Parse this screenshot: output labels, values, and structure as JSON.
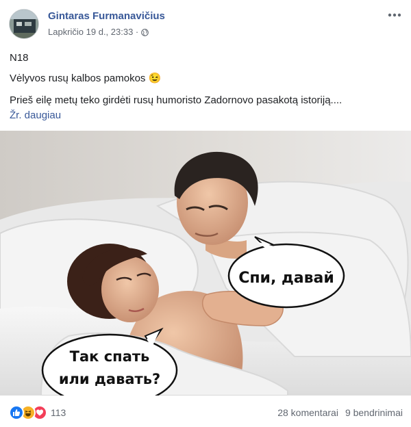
{
  "post": {
    "author": "Gintaras Furmanavičius",
    "timestamp": "Lapkričio 19 d., 23:33 ·",
    "privacy_icon": "globe-icon",
    "more_icon": "ellipsis-icon",
    "lines": [
      "N18",
      "Vėlyvos rusų kalbos pamokos 😉",
      "Prieš eilę metų teko girdėti rusų humoristo Zadornovo pasakotą istoriją...."
    ],
    "see_more": "Žr. daugiau"
  },
  "image": {
    "bubble_right": "Спи, давай",
    "bubble_left_line1": "Так спать",
    "bubble_left_line2": "или давать?"
  },
  "footer": {
    "reaction_icons": [
      "like-icon",
      "haha-icon",
      "love-icon"
    ],
    "reaction_count": "113",
    "comments": "28 komentarai",
    "shares": "9 bendrinimai"
  },
  "colors": {
    "link": "#385898",
    "secondary_text": "#616770",
    "like_blue": "#1877f2",
    "haha_yellow": "#f7b125",
    "love_red": "#f33e58"
  }
}
